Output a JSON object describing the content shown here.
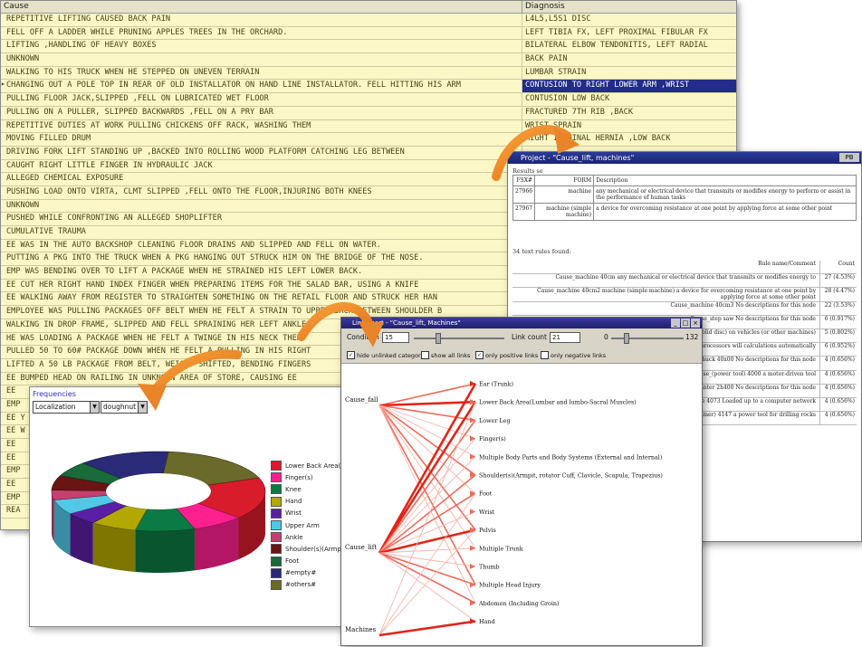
{
  "grid": {
    "headers": {
      "cause": "Cause",
      "diagnosis": "Diagnosis"
    },
    "rows": [
      {
        "cause": "REPETITIVE LIFTING CAUSED BACK PAIN",
        "diagnosis": "L4L5,L5S1 DISC"
      },
      {
        "cause": "FELL OFF A LADDER WHILE PRUNING APPLES TREES IN THE ORCHARD.",
        "diagnosis": "LEFT TIBIA FX, LEFT PROXIMAL FIBULAR FX"
      },
      {
        "cause": "LIFTING ,HANDLING OF HEAVY BOXES",
        "diagnosis": "BILATERAL ELBOW TENDONITIS, LEFT RADIAL"
      },
      {
        "cause": "UNKNOWN",
        "diagnosis": "BACK PAIN"
      },
      {
        "cause": "WALKING TO HIS TRUCK WHEN HE STEPPED ON UNEVEN TERRAIN",
        "diagnosis": "LUMBAR STRAIN"
      },
      {
        "cause": "CHANGING OUT A POLE TOP IN REAR OF OLD INSTALLATOR ON HAND LINE INSTALLATOR. FELL HITTING HIS ARM",
        "diagnosis": "CONTUSION TO RIGHT LOWER ARM ,WRIST",
        "selected": true
      },
      {
        "cause": "PULLING FLOOR JACK,SLIPPED ,FELL ON LUBRICATED WET FLOOR",
        "diagnosis": "CONTUSION LOW BACK"
      },
      {
        "cause": "PULLING ON A PULLER, SLIPPED BACKWARDS ,FELL ON A PRY BAR",
        "diagnosis": "FRACTURED 7TH RIB ,BACK"
      },
      {
        "cause": "REPETITIVE DUTIES AT WORK PULLING CHICKENS OFF RACK,     WASHING THEM",
        "diagnosis": "WRIST SPRAIN"
      },
      {
        "cause": "MOVING FILLED DRUM",
        "diagnosis": "RIGHT INGUINAL HERNIA ,LOW BACK"
      },
      {
        "cause": "DRIVING FORK LIFT STANDING UP ,BACKED INTO ROLLING WOOD PLATFORM CATCHING LEG BETWEEN",
        "diagnosis": ""
      },
      {
        "cause": "CAUGHT RIGHT LITTLE FINGER IN HYDRAULIC JACK",
        "diagnosis": ""
      },
      {
        "cause": "ALLEGED CHEMICAL EXPOSURE",
        "diagnosis": ""
      },
      {
        "cause": "PUSHING LOAD ONTO VIRTA, CLMT SLIPPED ,FELL ONTO THE FLOOR,INJURING BOTH KNEES",
        "diagnosis": ""
      },
      {
        "cause": "UNKNOWN",
        "diagnosis": ""
      },
      {
        "cause": "PUSHED WHILE CONFRONTING AN ALLEGED SHOPLIFTER",
        "diagnosis": ""
      },
      {
        "cause": "CUMULATIVE TRAUMA",
        "diagnosis": ""
      },
      {
        "cause": "EE WAS IN THE AUTO BACKSHOP CLEANING FLOOR DRAINS AND SLIPPED AND FELL ON WATER.",
        "diagnosis": ""
      },
      {
        "cause": "PUTTING A PKG INTO THE TRUCK WHEN A PKG HANGING OUT STRUCK HIM ON THE BRIDGE OF THE NOSE.",
        "diagnosis": ""
      },
      {
        "cause": "EMP WAS BENDING OVER TO LIFT A PACKAGE WHEN HE STRAINED HIS LEFT LOWER BACK.",
        "diagnosis": ""
      },
      {
        "cause": "EE CUT HER RIGHT HAND INDEX FINGER WHEN PREPARING ITEMS FOR THE SALAD BAR, USING A KNIFE",
        "diagnosis": ""
      },
      {
        "cause": "EE WALKING AWAY FROM REGISTER TO STRAIGHTEN SOMETHING ON THE RETAIL FLOOR AND STRUCK HER HAN",
        "diagnosis": ""
      },
      {
        "cause": "EMPLOYEE WAS PULLING PACKAGES OFF BELT WHEN HE FELT A STRAIN TO UPPER BACK BETWEEN SHOULDER B",
        "diagnosis": ""
      },
      {
        "cause": "WALKING IN DROP FRAME, SLIPPED AND FELL SPRAINING HER LEFT ANKLE",
        "diagnosis": ""
      },
      {
        "cause": "HE WAS LOADING A PACKAGE WHEN HE FELT A TWINGE IN HIS NECK THEN",
        "diagnosis": ""
      },
      {
        "cause": "PULLED 50 TO 60# PACKAGE DOWN WHEN HE FELT A PULLING IN HIS  RIGHT",
        "diagnosis": ""
      },
      {
        "cause": "LIFTED A 50 LB PACKAGE FROM BELT, WEIGHT SHIFTED, BENDING FINGERS",
        "diagnosis": ""
      },
      {
        "cause": "EE BUMPED HEAD ON RAILING IN UNKNOWN AREA OF STORE, CAUSING EE",
        "diagnosis": ""
      },
      {
        "cause": "EE",
        "diagnosis": ""
      },
      {
        "cause": "EMP",
        "diagnosis": ""
      },
      {
        "cause": "EE Y",
        "diagnosis": ""
      },
      {
        "cause": "EE W",
        "diagnosis": ""
      },
      {
        "cause": "EE",
        "diagnosis": ""
      },
      {
        "cause": "EE",
        "diagnosis": ""
      },
      {
        "cause": "EMP",
        "diagnosis": ""
      },
      {
        "cause": "EE",
        "diagnosis": ""
      },
      {
        "cause": "EMP",
        "diagnosis": ""
      },
      {
        "cause": "REA",
        "diagnosis": ""
      }
    ]
  },
  "project": {
    "title": "Project - \"Cause_lift, machines\"",
    "close_label": "PB",
    "search_label": "Results se",
    "result_rows": [
      {
        "id": "FSX#",
        "term": "FORM",
        "desc": "Description"
      },
      {
        "id": "27966",
        "term": "machine",
        "desc": "any mechanical or electrical device that transmits or modifies energy to perform or assist in the performance of human tasks"
      },
      {
        "id": "27967",
        "term": "machine (simple machine)",
        "desc": "a device for overcoming resistance at one point by applying force at some other point"
      }
    ],
    "rules_found_label": "34 text rules found:",
    "rules_header": {
      "rule": "Rule name/Comment",
      "count": "Count"
    },
    "rules": [
      {
        "text": "Cause_machine 40cm any mechanical or electrical device that transmits or modifies energy to",
        "count": "27 (4.53%)"
      },
      {
        "text": "Cause_machine 40cm2 machine (simple machine) a device for overcoming resistance at one point by applying force at some other point",
        "count": "28 (4.47%)"
      },
      {
        "text": "Cause_machine 40cm3 No descriptions for this node",
        "count": "22 (3.53%)"
      },
      {
        "text": "Cause_step saw No descriptions for this node",
        "count": "6 (0.917%)"
      },
      {
        "text": "Cause_chuck 3700 With cheeks (or a solid disc) on vehicles (or other machines)",
        "count": "5 (0.802%)"
      },
      {
        "text": "Computer when processors will calculations automatically",
        "count": "6 (0.952%)"
      },
      {
        "text": "Cause_chuck 40x00 No descriptions for this node",
        "count": "4 (0.656%)"
      },
      {
        "text": "Cause_(power tool) 4000 a motor-driven tool",
        "count": "4 (0.656%)"
      },
      {
        "text": "Cause_counter 2h400 No descriptions for this node",
        "count": "4 (0.656%)"
      },
      {
        "text": "Cause_chuck guest node 4073 Loaded up to a computer network",
        "count": "4 (0.656%)"
      },
      {
        "text": "Cause_hammer (power hammer) 4147 a power tool for drilling rocks",
        "count": "4 (0.656%)"
      }
    ]
  },
  "pie": {
    "title": "Frequencies",
    "select_left": "Localization",
    "select_right": "doughnut",
    "legend": [
      {
        "label": "Lower Back Area(Lu",
        "color": "#d81c2c"
      },
      {
        "label": "Finger(s)",
        "color": "#ff2090"
      },
      {
        "label": "Knee",
        "color": "#0c7a44"
      },
      {
        "label": "Hand",
        "color": "#b2a800"
      },
      {
        "label": "Wrist",
        "color": "#5a1fa4"
      },
      {
        "label": "Upper Arm",
        "color": "#52c8e6"
      },
      {
        "label": "Ankle",
        "color": "#c44070"
      },
      {
        "label": "Shoulder(s)(Armp",
        "color": "#6a1414"
      },
      {
        "label": "Foot",
        "color": "#1a6a3a"
      },
      {
        "label": "#empty#",
        "color": "#2a2a78"
      },
      {
        "label": "#others#",
        "color": "#6a6a2a"
      }
    ]
  },
  "link": {
    "title": "Link chart - \"Cause_lift, Machines\"",
    "toolbar": {
      "condition_label": "Condition",
      "condition_value": "15",
      "link_count_label": "Link count",
      "link_count_value": "21",
      "range_min": "0",
      "range_max": "132",
      "checks": [
        {
          "label": "hide unlinked categories",
          "checked": true
        },
        {
          "label": "show all links",
          "checked": false
        },
        {
          "label": "only positive links",
          "checked": true
        },
        {
          "label": "only negative links",
          "checked": false
        }
      ]
    },
    "sources": [
      "Cause_fall",
      "Cause_lift",
      "Machines"
    ],
    "targets": [
      "Ear (Trunk)",
      "Lower Back Area(Lumbar and lumbo-Sacral Muscles)",
      "Lower Leg",
      "Finger(s)",
      "Multiple Body Parts and Body Systems (External and Internal)",
      "Shoulder(s)(Armpit, rotator Cuff, Clavicle, Scapula, Trapezius)",
      "Foot",
      "Wrist",
      "Pelvis",
      "Multiple Trunk",
      "Thumb",
      "Multiple Head Injury",
      "Abdomen (Including Groin)",
      "Hand"
    ]
  }
}
